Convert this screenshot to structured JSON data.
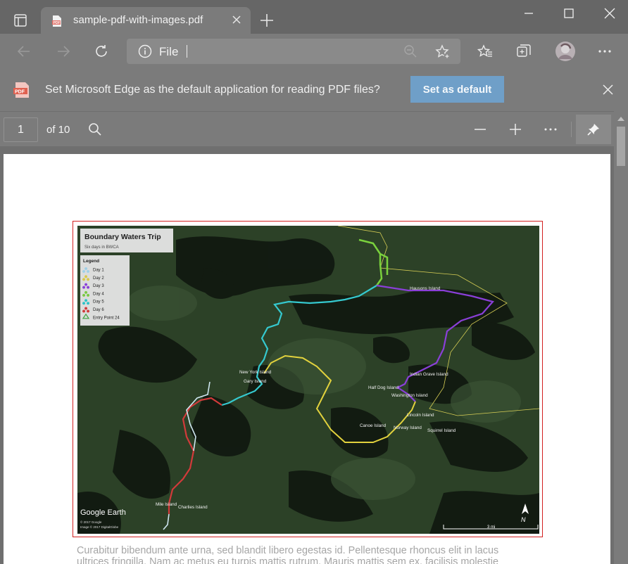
{
  "browser": {
    "tab_title": "sample-pdf-with-images.pdf",
    "address_label": "File"
  },
  "infobar": {
    "message": "Set Microsoft Edge as the default application for reading PDF files?",
    "button_label": "Set as default"
  },
  "pdf_toolbar": {
    "current_page": "1",
    "page_count_label": "of 10"
  },
  "document": {
    "map": {
      "title": "Boundary Waters Trip",
      "subtitle": "Six days in BWCA",
      "legend_title": "Legend",
      "legend_items": [
        {
          "label": "Day 1",
          "color": "#9fd0e8"
        },
        {
          "label": "Day 2",
          "color": "#d8c84a"
        },
        {
          "label": "Day 3",
          "color": "#8a3fd8"
        },
        {
          "label": "Day 4",
          "color": "#7ac943"
        },
        {
          "label": "Day 5",
          "color": "#2bc4c8"
        },
        {
          "label": "Day 6",
          "color": "#d03a3a"
        },
        {
          "label": "Entry Point 24",
          "color": "#3da33d"
        }
      ],
      "place_labels": [
        "Hausons Island",
        "New York Island",
        "Gary Island",
        "Indian Grave Island",
        "Half Dog Island",
        "Washington Island",
        "Lincoln Island",
        "Canoe Island",
        "Norway Island",
        "Squirrel Island",
        "Mile Island",
        "Charlies Island"
      ],
      "branding": "Google Earth",
      "copyright_1": "© 2017 Google",
      "copyright_2": "Image © 2017 DigitalGlobe",
      "scale_label": "3 mi",
      "north_label": "N"
    },
    "body_line_1": "Curabitur bibendum ante urna, sed blandit libero egestas id. Pellentesque rhoncus elit in lacus",
    "body_line_2": "ultrices fringilla. Nam ac metus eu turpis mattis rutrum. Mauris mattis sem ex, facilisis molestie"
  }
}
